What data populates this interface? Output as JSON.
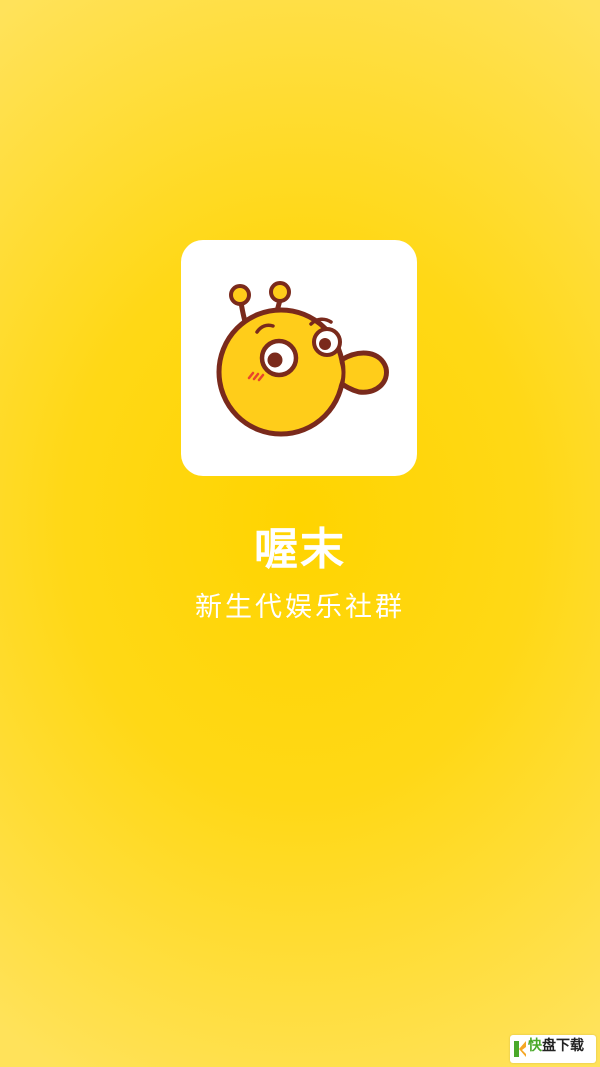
{
  "app": {
    "name": "喔末",
    "tagline": "新生代娱乐社群"
  },
  "watermark": {
    "brand_first": "快",
    "brand_rest": "盘下载"
  },
  "icons": {
    "logo": "yellow-bug-mascot-icon",
    "watermark": "kuaipan-logo-icon"
  },
  "colors": {
    "background": "#ffd400",
    "logo_card": "#ffffff",
    "mascot_fill": "#ffcd1a",
    "mascot_outline": "#7a2a1c",
    "text": "#ffffff"
  }
}
